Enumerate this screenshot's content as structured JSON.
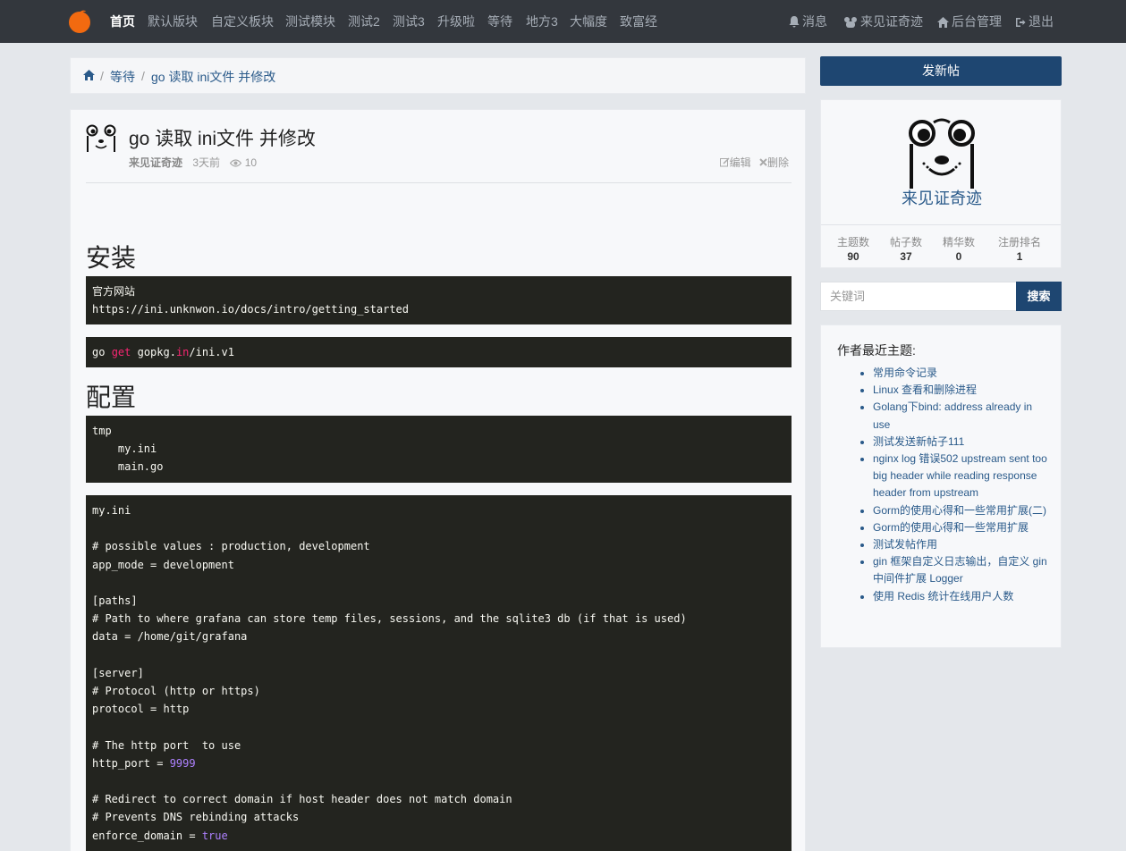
{
  "nav": {
    "items": [
      "首页",
      "默认版块",
      "自定义板块",
      "测试模块",
      "测试2",
      "测试3",
      "升级啦",
      "等待",
      "地方3",
      "大幅度",
      "致富经"
    ],
    "messages": "消息",
    "user": "来见证奇迹",
    "admin": "后台管理",
    "logout": "退出"
  },
  "breadcrumb": {
    "level1": "等待",
    "current": "go 读取 ini文件 并修改"
  },
  "post": {
    "title": "go 读取 ini文件 并修改",
    "author": "来见证奇迹",
    "time": "3天前",
    "views": "10",
    "edit": "编辑",
    "delete": "删除",
    "h_install": "安装",
    "h_config": "配置",
    "code1": [
      "官方网站",
      "https://ini.unknwon.io/docs/intro/getting_started"
    ],
    "code2": {
      "p1": "go ",
      "kw1": "get",
      "p2": " gopkg.",
      "kw2": "in",
      "p3": "/ini.v1"
    },
    "code3": [
      "tmp",
      "    my.ini",
      "    main.go"
    ],
    "code4": {
      "lines_a": "my.ini\n\n# possible values : production, development\napp_mode = development\n\n[paths]\n# Path to where grafana can store temp files, sessions, and the sqlite3 db (if that is used)\ndata = /home/git/grafana\n\n[server]\n# Protocol (http or https)\nprotocol = http\n\n# The http port  to use\nhttp_port = ",
      "port": "9999",
      "lines_b": "\n\n# Redirect to correct domain if host header does not match domain\n# Prevents DNS rebinding attacks\nenforce_domain = ",
      "bool": "true"
    }
  },
  "sidebar": {
    "new_post": "发新帖",
    "profile_name": "来见证奇迹",
    "stats": [
      {
        "label": "主题数",
        "value": "90"
      },
      {
        "label": "帖子数",
        "value": "37"
      },
      {
        "label": "精华数",
        "value": "0"
      },
      {
        "label": "注册排名",
        "value": "1"
      }
    ],
    "search_placeholder": "关键词",
    "search_button": "搜索",
    "recent_title": "作者最近主题:",
    "recent": [
      "常用命令记录",
      "Linux 查看和删除进程",
      "Golang下bind: address already in use",
      "测试发送新帖子111",
      "nginx log 错误502 upstream sent too big header while reading response header from upstream",
      "Gorm的使用心得和一些常用扩展(二)",
      "Gorm的使用心得和一些常用扩展",
      "测试发帖作用",
      "gin 框架自定义日志输出，自定义 gin 中间件扩展 Logger",
      "使用 Redis 统计在线用户人数"
    ]
  },
  "colors": {
    "navbar": "#33373d",
    "primary": "#1e4671",
    "link": "#2a5a8a",
    "code_bg": "#23241f",
    "logo": "#f26a10"
  }
}
